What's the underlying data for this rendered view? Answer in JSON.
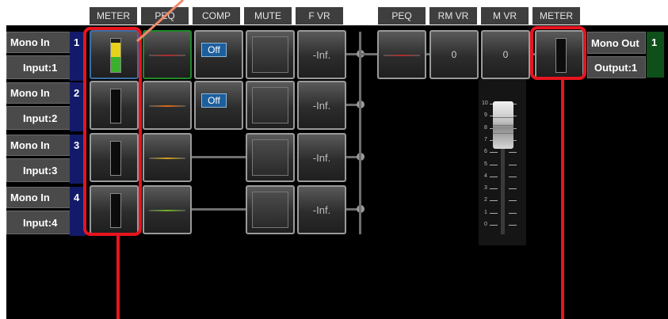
{
  "headers": {
    "input": [
      "METER",
      "PEQ",
      "COMP",
      "MUTE",
      "F VR"
    ],
    "output": [
      "PEQ",
      "RM VR",
      "M VR",
      "METER"
    ]
  },
  "channels": [
    {
      "name": "Mono In",
      "number": "1",
      "sub": "Input:1",
      "comp": "Off",
      "fvr": "-Inf.",
      "peq_color": "#b22a2a",
      "meter_level": 0.9
    },
    {
      "name": "Mono In",
      "number": "2",
      "sub": "Input:2",
      "comp": "Off",
      "fvr": "-Inf.",
      "peq_color": "#e06a10",
      "meter_level": 0
    },
    {
      "name": "Mono In",
      "number": "3",
      "sub": "Input:3",
      "comp": "",
      "fvr": "-Inf.",
      "peq_color": "#d4a017",
      "meter_level": 0
    },
    {
      "name": "Mono In",
      "number": "4",
      "sub": "Input:4",
      "comp": "",
      "fvr": "-Inf.",
      "peq_color": "#6fb51f",
      "meter_level": 0
    }
  ],
  "output": {
    "name": "Mono Out",
    "number": "1",
    "sub": "Output:1",
    "rm_vr": "0",
    "m_vr": "0",
    "peq_color": "#b22a2a"
  },
  "fader": {
    "scale": [
      "10",
      "9",
      "8",
      "7",
      "6",
      "5",
      "4",
      "3",
      "2",
      "1",
      "0"
    ],
    "level": 10
  },
  "colors": {
    "highlight": "#e8141e",
    "arrow": "#f08a6a",
    "input_num_bg": "#141a6a",
    "output_num_bg": "#0f4f1a",
    "comp_off": "#1d5f9c"
  }
}
